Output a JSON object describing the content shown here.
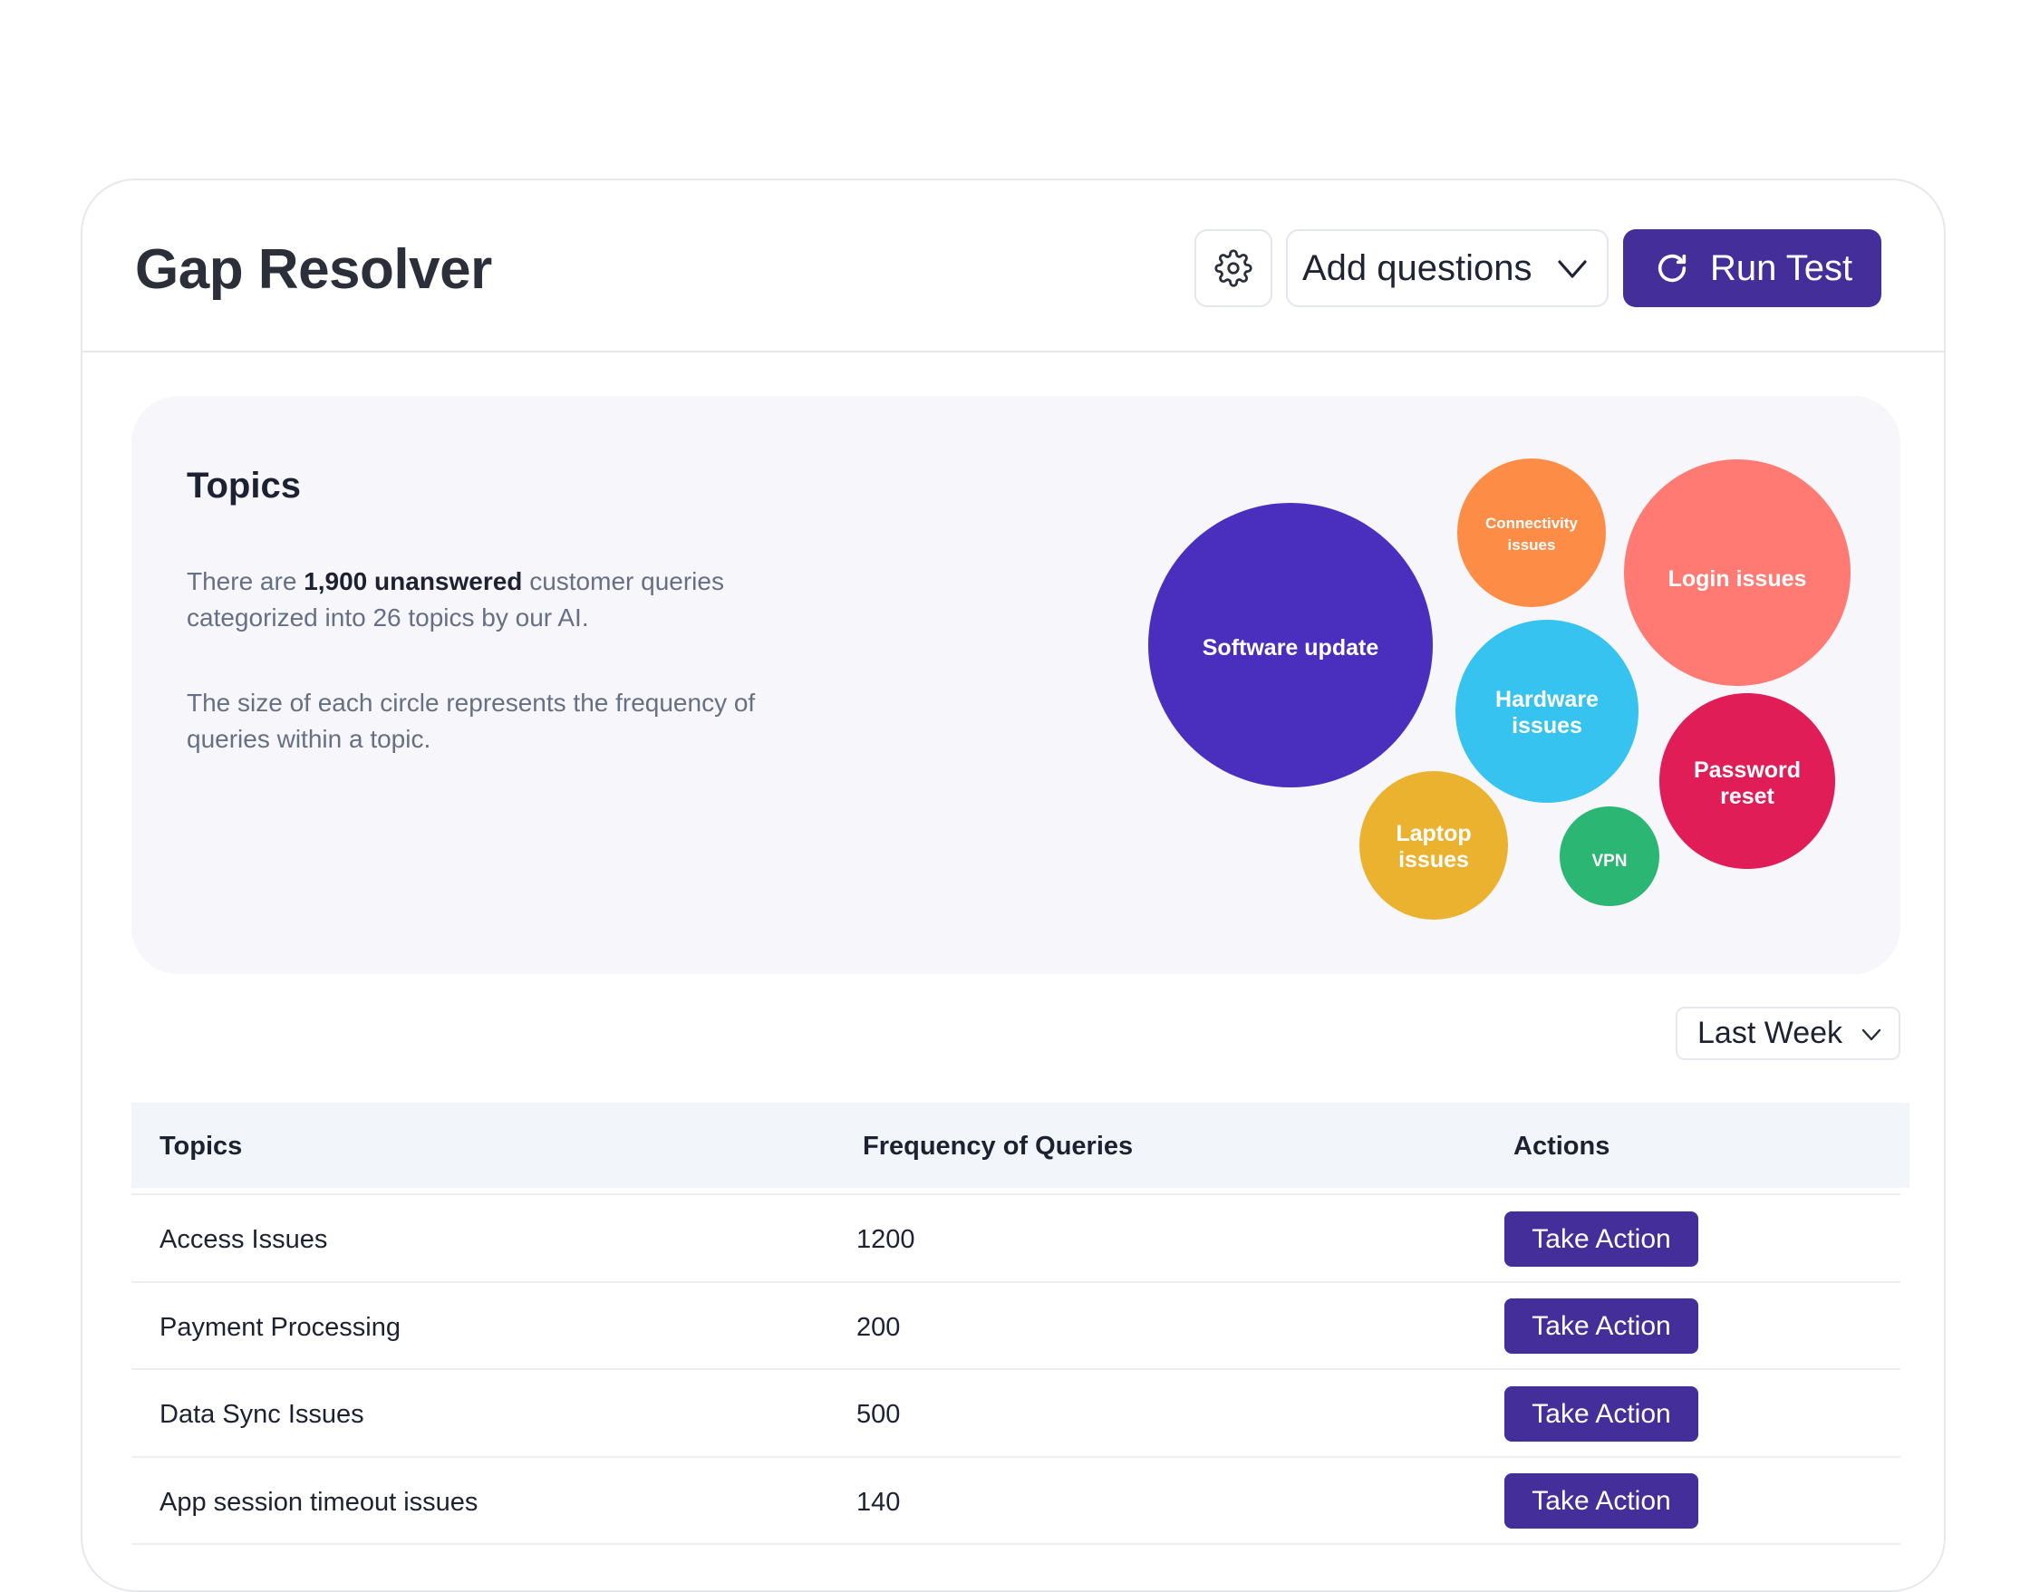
{
  "header": {
    "title": "Gap Resolver",
    "settings_icon": "gear-icon",
    "add_questions_label": "Add questions",
    "run_test_label": "Run Test",
    "accent_color": "#432e9a"
  },
  "topics_panel": {
    "heading": "Topics",
    "desc1_before": "There are",
    "desc1_bold": "1,900 unanswered",
    "desc1_after": "customer queries categorized into 26 topics by our AI.",
    "desc2": "The size of each circle represents the frequency of queries within a topic.",
    "bubbles": [
      {
        "label": "Software update",
        "color": "#4a2fbf"
      },
      {
        "label": "Connectivity issues",
        "color": "#fd8c46"
      },
      {
        "label": "Login issues",
        "color": "#ff7a73"
      },
      {
        "label": "Hardware issues",
        "color": "#36c3ef"
      },
      {
        "label": "Password reset",
        "color": "#e01d56"
      },
      {
        "label": "Laptop issues",
        "color": "#ebb22f"
      },
      {
        "label": "VPN",
        "color": "#2bb673"
      }
    ]
  },
  "filter": {
    "period_label": "Last Week"
  },
  "table": {
    "columns": [
      "Topics",
      "Frequency of Queries",
      "Actions"
    ],
    "rows": [
      {
        "topic": "Access Issues",
        "frequency": "1200",
        "action": "Take Action"
      },
      {
        "topic": "Payment Processing",
        "frequency": "200",
        "action": "Take Action"
      },
      {
        "topic": "Data Sync Issues",
        "frequency": "500",
        "action": "Take Action"
      },
      {
        "topic": "App session timeout issues",
        "frequency": "140",
        "action": "Take Action"
      }
    ]
  }
}
